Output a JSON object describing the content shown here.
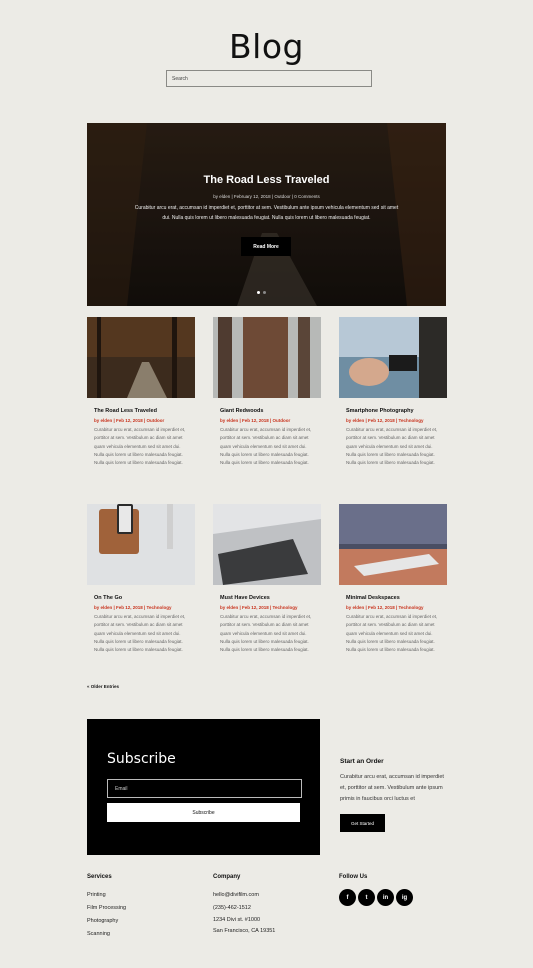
{
  "page": {
    "title": "Blog"
  },
  "search": {
    "placeholder": "Search"
  },
  "hero": {
    "title": "The Road Less Traveled",
    "meta": "by elden | February 12, 2018 | Outdoor | 0 Comments",
    "excerpt": "Curabitur arcu erat, accumsan id imperdiet et, porttitor at sem. Vestibulum ante ipsum vehicula elementum sed sit amet dui. Nulla quis lorem ut libero malesuada feugiat. Nulla quis lorem ut libero malesuada feugiat.",
    "button_label": "Read More",
    "slide_count": 2,
    "active_slide": 1
  },
  "posts": [
    {
      "title": "The Road Less Traveled",
      "meta": "by elden | Feb 12, 2018 | Outdoor",
      "image": "forest-road",
      "excerpt": "Curabitur arcu erat, accumsan id imperdiet et, porttitor at sem. Vestibulum ac diam sit amet quam vehicula elementum sed sit amet dui. Nulla quis lorem ut libero malesuada feugiat. Nulla quis lorem ut libero malesuada feugiat."
    },
    {
      "title": "Giant Redwoods",
      "meta": "by elden | Feb 12, 2018 | Outdoor",
      "image": "redwoods",
      "excerpt": "Curabitur arcu erat, accumsan id imperdiet et, porttitor at sem. Vestibulum ac diam sit amet quam vehicula elementum sed sit amet dui. Nulla quis lorem ut libero malesuada feugiat. Nulla quis lorem ut libero malesuada feugiat."
    },
    {
      "title": "Smartphone Photography",
      "meta": "by elden | Feb 12, 2018 | Technology",
      "image": "phone-photo",
      "excerpt": "Curabitur arcu erat, accumsan id imperdiet et, porttitor at sem. Vestibulum ac diam sit amet quam vehicula elementum sed sit amet dui. Nulla quis lorem ut libero malesuada feugiat. Nulla quis lorem ut libero malesuada feugiat."
    },
    {
      "title": "On The Go",
      "meta": "by elden | Feb 12, 2018 | Technology",
      "image": "phone-desk",
      "excerpt": "Curabitur arcu erat, accumsan id imperdiet et, porttitor at sem. Vestibulum ac diam sit amet quam vehicula elementum sed sit amet dui. Nulla quis lorem ut libero malesuada feugiat. Nulla quis lorem ut libero malesuada feugiat."
    },
    {
      "title": "Must Have Devices",
      "meta": "by elden | Feb 12, 2018 | Technology",
      "image": "laptop",
      "excerpt": "Curabitur arcu erat, accumsan id imperdiet et, porttitor at sem. Vestibulum ac diam sit amet quam vehicula elementum sed sit amet dui. Nulla quis lorem ut libero malesuada feugiat. Nulla quis lorem ut libero malesuada feugiat."
    },
    {
      "title": "Minimal Deskspaces",
      "meta": "by elden | Feb 12, 2018 | Technology",
      "image": "keyboard",
      "excerpt": "Curabitur arcu erat, accumsan id imperdiet et, porttitor at sem. Vestibulum ac diam sit amet quam vehicula elementum sed sit amet dui. Nulla quis lorem ut libero malesuada feugiat. Nulla quis lorem ut libero malesuada feugiat."
    }
  ],
  "pagination": {
    "older_label": "« Older Entries"
  },
  "subscribe": {
    "title": "Subscribe",
    "email_placeholder": "Email",
    "button_label": "Subscribe"
  },
  "order": {
    "title": "Start an Order",
    "text": "Curabitur arcu erat, accumsan id imperdiet et, porttitor at sem. Vestibulum ante ipsum primis in faucibus orci luctus et",
    "button_label": "Get Started"
  },
  "footer": {
    "services": {
      "heading": "Services",
      "items": [
        "Printing",
        "Film Processing",
        "Photography",
        "Scanning"
      ]
    },
    "company": {
      "heading": "Company",
      "items": [
        "hello@divifilm.com",
        "(235)-462-1512",
        "1234 Divi st. #1000",
        "San Francisco, CA 19351"
      ]
    },
    "follow": {
      "heading": "Follow Us",
      "icons": [
        "facebook-icon",
        "twitter-icon",
        "linkedin-icon",
        "instagram-icon"
      ],
      "glyphs": [
        "f",
        "t",
        "in",
        "ig"
      ]
    }
  },
  "colors": {
    "background": "#ecebe6",
    "accent": "#c8321c",
    "dark": "#000000"
  }
}
